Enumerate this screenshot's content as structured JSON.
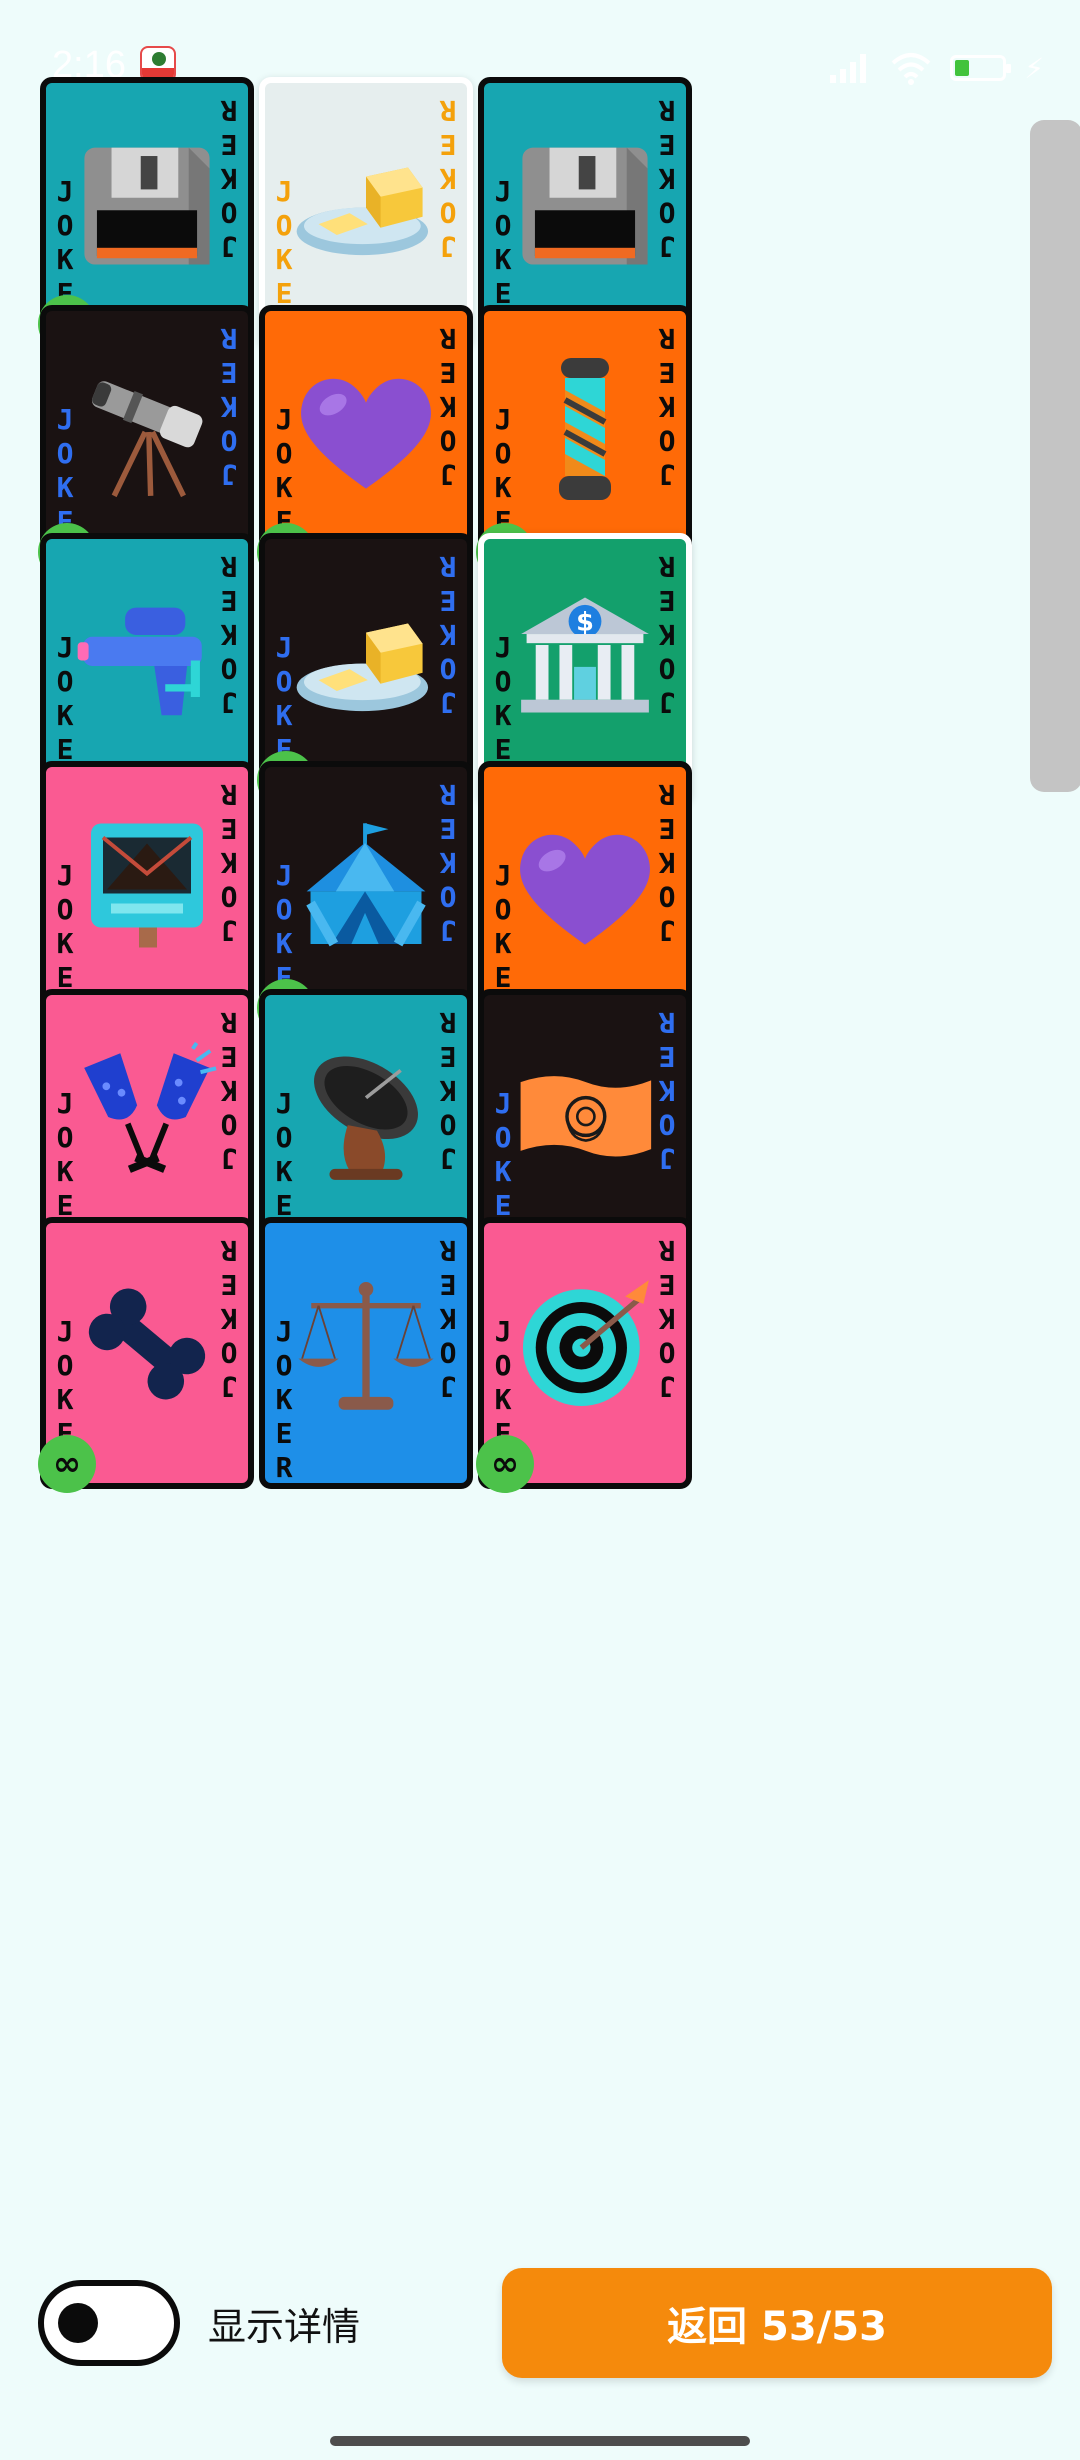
{
  "status": {
    "time": "2:16",
    "carrier_icon": "china-mobile-icon",
    "icons": [
      "signal-icon",
      "wifi-icon",
      "battery-icon",
      "charging-icon"
    ]
  },
  "joker": {
    "top_text": "JOKER",
    "side_text": "JOKER",
    "badge": "∞"
  },
  "cards": [
    {
      "name": "card-floppy-disk",
      "bg": "#17a6b1",
      "text_color": "#0b0b0b",
      "icon": "floppy-disk-icon",
      "infinite": true
    },
    {
      "name": "card-butter",
      "bg": "#e6eeee",
      "text_color": "#f4a10b",
      "icon": "butter-icon",
      "infinite": false
    },
    {
      "name": "card-floppy-disk-2",
      "bg": "#17a6b1",
      "text_color": "#0b0b0b",
      "icon": "floppy-disk-icon",
      "infinite": false
    },
    {
      "name": "card-telescope",
      "bg": "#1a1212",
      "text_color": "#2f6ef0",
      "icon": "telescope-icon",
      "infinite": true
    },
    {
      "name": "card-purple-heart",
      "bg": "#ff6a07",
      "text_color": "#0b0b0b",
      "icon": "purple-heart-icon",
      "infinite": true
    },
    {
      "name": "card-barber-pole",
      "bg": "#ff6a07",
      "text_color": "#0b0b0b",
      "icon": "barber-pole-icon",
      "infinite": true
    },
    {
      "name": "card-water-pistol",
      "bg": "#17a6b1",
      "text_color": "#0b0b0b",
      "icon": "water-pistol-icon",
      "infinite": false
    },
    {
      "name": "card-butter-dark",
      "bg": "#1a1212",
      "text_color": "#2f6ef0",
      "icon": "butter-icon",
      "infinite": true
    },
    {
      "name": "card-bank",
      "bg": "#13a06c",
      "text_color": "#0b0b0b",
      "icon": "bank-icon",
      "infinite": false
    },
    {
      "name": "card-mailbox",
      "bg": "#fa5a92",
      "text_color": "#0b0b0b",
      "icon": "mailbox-icon",
      "infinite": false
    },
    {
      "name": "card-circus-tent",
      "bg": "#1a1212",
      "text_color": "#2f6ef0",
      "icon": "circus-tent-icon",
      "infinite": true
    },
    {
      "name": "card-purple-heart-2",
      "bg": "#ff6a07",
      "text_color": "#0b0b0b",
      "icon": "purple-heart-icon",
      "infinite": false
    },
    {
      "name": "card-clinking-glasses",
      "bg": "#fa5a92",
      "text_color": "#0b0b0b",
      "icon": "clinking-glasses-icon",
      "infinite": false
    },
    {
      "name": "card-satellite-antenna",
      "bg": "#17a6b1",
      "text_color": "#0b0b0b",
      "icon": "satellite-antenna-icon",
      "infinite": false
    },
    {
      "name": "card-un-flag",
      "bg": "#1a1212",
      "text_color": "#2f6ef0",
      "icon": "united-nations-flag-icon",
      "infinite": false
    },
    {
      "name": "card-bone",
      "bg": "#fa5a92",
      "text_color": "#0b0b0b",
      "icon": "bone-icon",
      "infinite": true
    },
    {
      "name": "card-balance-scale",
      "bg": "#1e8fe8",
      "text_color": "#0b0b0b",
      "icon": "balance-scale-icon",
      "infinite": false
    },
    {
      "name": "card-bullseye",
      "bg": "#fa5a92",
      "text_color": "#0b0b0b",
      "icon": "bullseye-icon",
      "infinite": true
    }
  ],
  "bottom": {
    "toggle_label": "显示详情",
    "toggle_on": false,
    "return_button": "返回 53/53"
  }
}
